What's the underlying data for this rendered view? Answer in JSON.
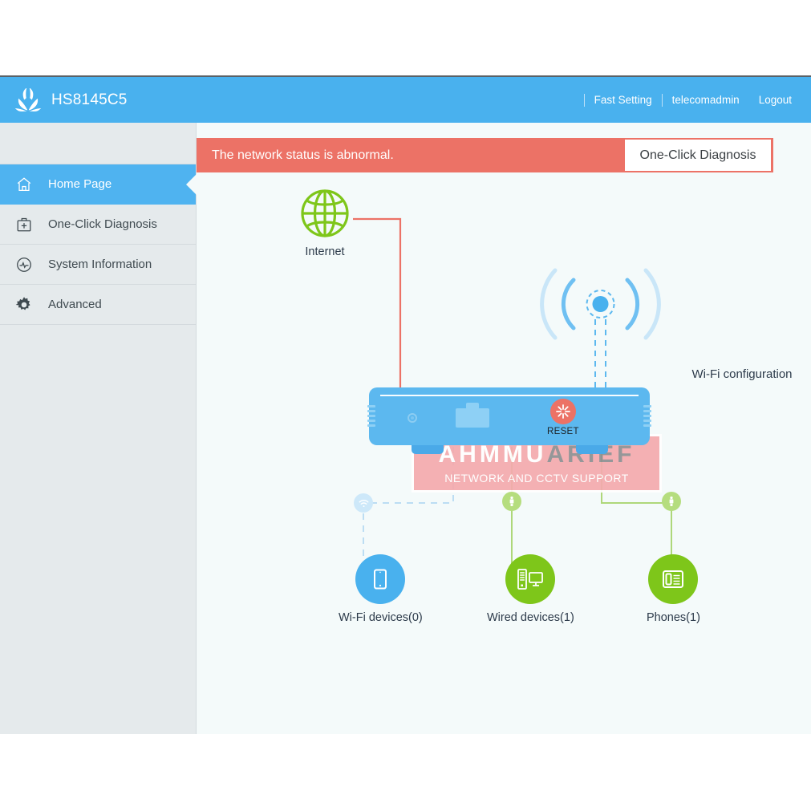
{
  "header": {
    "brand": "HS8145C5",
    "logo_icon": "huawei-logo-icon",
    "nav": [
      {
        "label": "Fast Setting",
        "name": "fast-setting"
      },
      {
        "label": "telecomadmin",
        "name": "account"
      },
      {
        "label": "Logout",
        "name": "logout"
      }
    ]
  },
  "sidebar": {
    "items": [
      {
        "label": "Home Page",
        "icon": "home-icon",
        "active": true
      },
      {
        "label": "One-Click Diagnosis",
        "icon": "first-aid-kit-icon",
        "active": false
      },
      {
        "label": "System Information",
        "icon": "activity-circle-icon",
        "active": false
      },
      {
        "label": "Advanced",
        "icon": "gear-icon",
        "active": false
      }
    ]
  },
  "alert": {
    "message": "The network status is abnormal.",
    "button_label": "One-Click Diagnosis",
    "background_color": "#ec7266",
    "text_color": "#ffffff"
  },
  "topology": {
    "internet": {
      "label": "Internet",
      "icon": "globe-icon",
      "color": "#7ec61a",
      "status": "error"
    },
    "error_badge": {
      "icon": "error-x-icon",
      "color": "#ec7266"
    },
    "wifi_configuration": {
      "label": "Wi-Fi configuration",
      "icon": "wifi-broadcast-icon",
      "color": "#49b1ee"
    },
    "router": {
      "reset_label": "RESET",
      "reset_icon": "reset-burst-icon",
      "body_color": "#5cb8ef",
      "reset_color": "#ec7266"
    },
    "devices": [
      {
        "label": "Wi-Fi devices(0)",
        "icon": "tablet-icon",
        "color": "#49b1ee",
        "link": "dashed",
        "badge_icon": "wifi-signal-icon"
      },
      {
        "label": "Wired devices(1)",
        "icon": "desktop-tower-icon",
        "color": "#7ec61a",
        "link": "solid",
        "badge_icon": "ethernet-plug-icon"
      },
      {
        "label": "Phones(1)",
        "icon": "desk-phone-icon",
        "color": "#7ec61a",
        "link": "solid",
        "badge_icon": "ethernet-plug-icon"
      }
    ]
  },
  "watermark": {
    "title_part1": "AHMMU",
    "title_part2": "ARIEF",
    "subtitle": "NETWORK  AND CCTV SUPPORT",
    "background_color": "#f4aaad"
  }
}
